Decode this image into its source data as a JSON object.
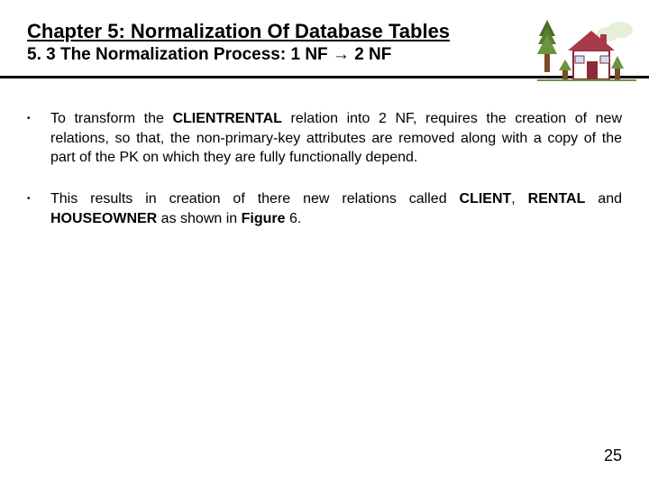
{
  "header": {
    "chapter_title": "Chapter 5: Normalization Of Database Tables",
    "section_title": "5. 3 The Normalization Process: 1 NF → 2 NF"
  },
  "bullets": [
    {
      "pre": "To transform the ",
      "bold1": "CLIENTRENTAL",
      "post": " relation into 2 NF, requires the creation of new relations, so that, the non-primary-key attributes are removed along with a copy of the part of the PK on which they are fully functionally depend."
    },
    {
      "pre": "This results in creation of there new relations called ",
      "bold1": "CLIENT",
      "mid1": ", ",
      "bold2": "RENTAL",
      "mid2": " and ",
      "bold3": "HOUSEOWNER",
      "mid3": " as shown in ",
      "bold4": "Figure",
      "post": " 6."
    }
  ],
  "page_number": "25"
}
